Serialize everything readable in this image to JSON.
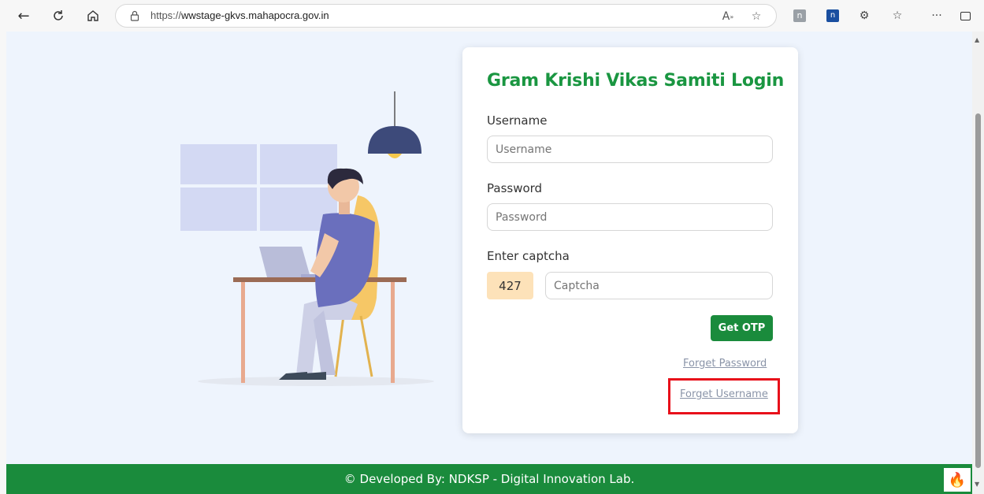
{
  "browser": {
    "url_prefix": "https://",
    "url_host": "wwstage-gkvs.mahapocra.gov.in",
    "more_label": "···"
  },
  "login": {
    "title": "Gram Krishi Vikas Samiti Login",
    "username_label": "Username",
    "username_placeholder": "Username",
    "password_label": "Password",
    "password_placeholder": "Password",
    "captcha_label": "Enter captcha",
    "captcha_code": "427",
    "captcha_placeholder": "Captcha",
    "get_otp": "Get OTP",
    "forget_password": "Forget Password",
    "forget_username": "Forget Username"
  },
  "footer": {
    "text": "© Developed By: NDKSP - Digital Innovation Lab."
  },
  "colors": {
    "brand_green": "#1a8b3c",
    "title_green": "#1a9641",
    "highlight_red": "#e8101a",
    "page_bg": "#eef4fd"
  }
}
